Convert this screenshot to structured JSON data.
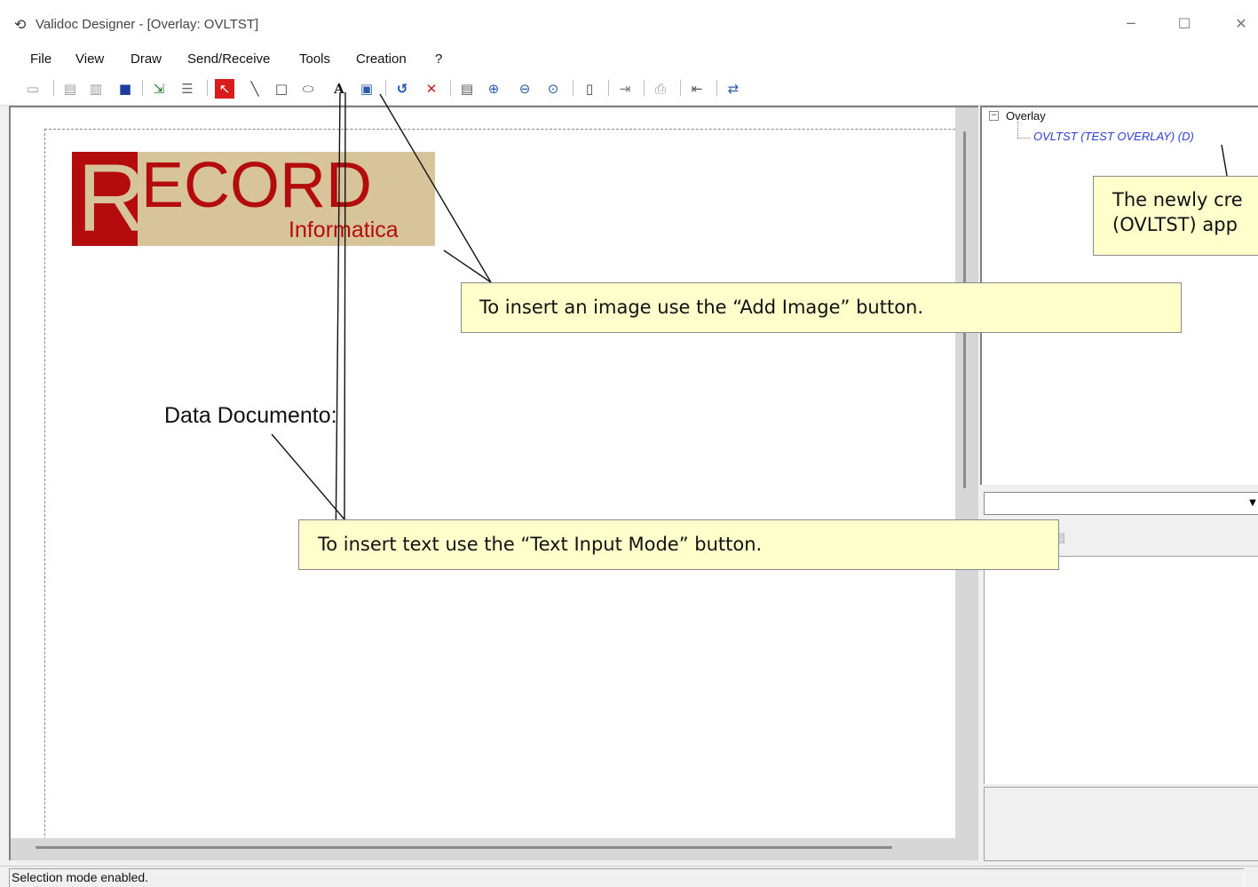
{
  "window": {
    "title": "Validoc Designer - [Overlay: OVLTST]",
    "app_icon": "validoc-icon",
    "minimize_icon": "minimize-icon",
    "maximize_icon": "maximize-icon",
    "close_icon": "close-icon"
  },
  "menu": [
    "File",
    "View",
    "Draw",
    "Send/Receive",
    "Tools",
    "Creation",
    "?"
  ],
  "toolbar": {
    "icons": [
      "open-icon",
      "new-icon",
      "open-folder-icon",
      "save-icon",
      "send-icon",
      "properties-icon",
      "selection-mode-icon",
      "line-icon",
      "rectangle-icon",
      "ellipse-icon",
      "text-input-mode-icon",
      "add-image-icon",
      "undo-icon",
      "delete-icon",
      "preview-icon",
      "zoom-in-icon",
      "zoom-out-icon",
      "zoom-fit-icon",
      "page-icon",
      "export-icon",
      "print-icon",
      "import-icon",
      "transfer-icon"
    ]
  },
  "document": {
    "logo": {
      "letter": "R",
      "word": "ECORD",
      "sub": "Informatica"
    },
    "label": "Data Documento:"
  },
  "tree": {
    "root": "Overlay",
    "child": "OVLTST (TEST OVERLAY) (D)",
    "expander": "⊟"
  },
  "properties": {
    "combo_value": "",
    "categorized_icon": "categorized-icon",
    "alphabetical_icon": "alphabetical-icon",
    "property-pages-icon": "property-pages-icon"
  },
  "callouts": {
    "image": "To insert an image use the “Add Image” button.",
    "text": "To insert text use the “Text Input Mode” button.",
    "overlay_line1": "The newly cre",
    "overlay_line2": "(OVLTST) app"
  },
  "status": {
    "text": "Selection mode enabled."
  },
  "colors": {
    "logo_red": "#b40c0c",
    "logo_tan": "#d8c49b",
    "callout_bg": "#ffffcc",
    "tree_link": "#2a3fe0"
  }
}
